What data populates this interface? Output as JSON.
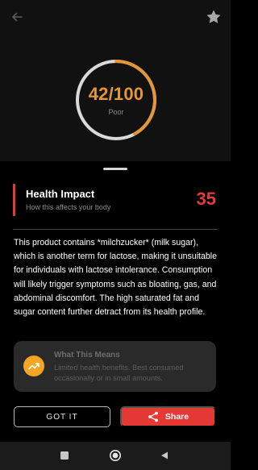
{
  "header": {
    "back_icon": "arrow-left-icon",
    "favorite_icon": "star-icon"
  },
  "score": {
    "value": 42,
    "max": 100,
    "text": "42/100",
    "rating": "Poor",
    "gauge_color": "#e29639",
    "track_color": "#d9d9d9"
  },
  "impact": {
    "title": "Health Impact",
    "subtitle": "How this affects your body",
    "score": "35",
    "accent_color": "#e23b3b",
    "description": "This product contains *milchzucker* (milk sugar), which is another term for lactose, making it unsuitable for individuals with lactose intolerance. Consumption will likely trigger symptoms such as bloating, gas, and abdominal discomfort. The high saturated fat and sugar content further detract from its health profile."
  },
  "meaning": {
    "title": "What This Means",
    "text": "Limited health benefits. Best consumed occasionally or in small amounts.",
    "icon": "trending-up-icon",
    "icon_color": "#f5a524"
  },
  "actions": {
    "got_it": "GOT IT",
    "share": "Share",
    "share_icon": "share-icon",
    "share_color": "#e53935"
  },
  "system_nav": {
    "items": [
      "recents-square-icon",
      "home-circle-icon",
      "back-triangle-icon"
    ]
  }
}
